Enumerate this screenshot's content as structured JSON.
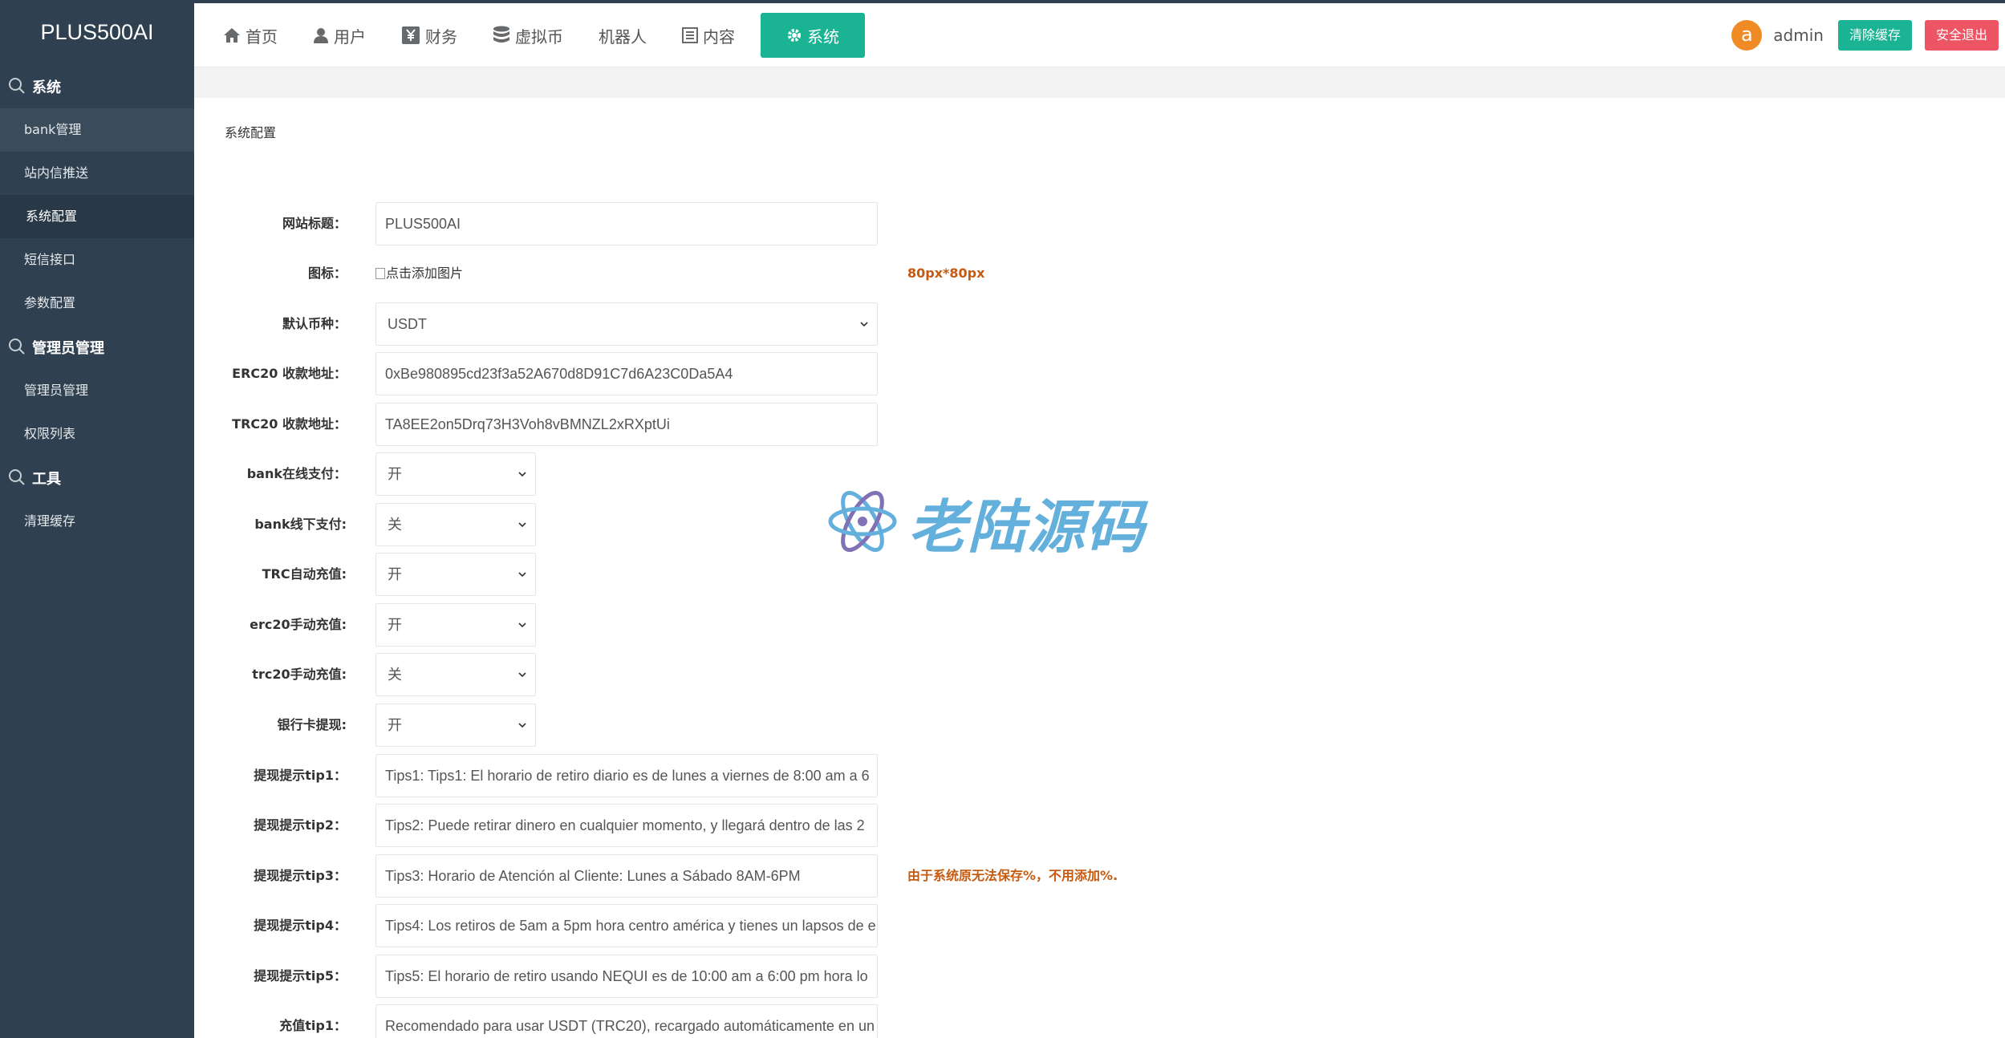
{
  "sidebar": {
    "brand": "PLUS500AI",
    "groups": [
      {
        "title": "系统",
        "items": [
          "bank管理",
          "站内信推送",
          "系统配置",
          "短信接口",
          "参数配置"
        ]
      },
      {
        "title": "管理员管理",
        "items": [
          "管理员管理",
          "权限列表"
        ]
      },
      {
        "title": "工具",
        "items": [
          "清理缓存"
        ]
      }
    ]
  },
  "topbar": {
    "menu": [
      "首页",
      "用户",
      "财务",
      "虚拟币",
      "机器人",
      "内容",
      "系统"
    ],
    "active_menu": "系统",
    "avatar_letter": "a",
    "username": "admin",
    "clear_cache_label": "清除缓存",
    "logout_label": "安全退出"
  },
  "page": {
    "title": "系统配置"
  },
  "form": {
    "site_title": {
      "label": "网站标题：",
      "value": "PLUS500AI"
    },
    "icon": {
      "label": "图标：",
      "alt": "点击添加图片",
      "hint": "80px*80px"
    },
    "default_currency": {
      "label": "默认币种：",
      "value": "USDT"
    },
    "erc20_address": {
      "label": "ERC20 收款地址：",
      "value": "0xBe980895cd23f3a52A670d8D91C7d6A23C0Da5A4"
    },
    "trc20_address": {
      "label": "TRC20 收款地址：",
      "value": "TA8EE2on5Drq73H3Voh8vBMNZL2xRXptUi"
    },
    "bank_online": {
      "label": "bank在线支付：",
      "value": "开"
    },
    "bank_offline": {
      "label": "bank线下支付:",
      "value": "关"
    },
    "trc_auto": {
      "label": "TRC自动充值:",
      "value": "开"
    },
    "erc20_manual": {
      "label": "erc20手动充值:",
      "value": "开"
    },
    "trc20_manual": {
      "label": "trc20手动充值:",
      "value": "关"
    },
    "bank_withdraw": {
      "label": "银行卡提现:",
      "value": "开"
    },
    "tip1": {
      "label": "提现提示tip1：",
      "value": "Tips1: Tips1: El horario de retiro diario es de lunes a viernes de 8:00 am a 6"
    },
    "tip2": {
      "label": "提现提示tip2：",
      "value": "Tips2: Puede retirar dinero en cualquier momento, y llegará dentro de las 2"
    },
    "tip3": {
      "label": "提现提示tip3：",
      "value": "Tips3: Horario de Atención al Cliente: Lunes a Sábado 8AM-6PM",
      "hint": "由于系统原无法保存%，不用添加%."
    },
    "tip4": {
      "label": "提现提示tip4：",
      "value": "Tips4: Los retiros de 5am a 5pm hora centro américa y tienes un lapsos de e"
    },
    "tip5": {
      "label": "提现提示tip5：",
      "value": "Tips5: El horario de retiro usando NEQUI es de 10:00 am a 6:00 pm hora lo"
    },
    "recharge_tip1": {
      "label": "充值tip1：",
      "value": "Recomendado para usar USDT (TRC20), recargado automáticamente en un"
    }
  },
  "watermark": "老陆源码",
  "colors": {
    "sidebar": "#2f4050",
    "accent": "#1ab394",
    "danger": "#ed5565",
    "hint": "#c55a11",
    "avatar": "#f08a24"
  }
}
